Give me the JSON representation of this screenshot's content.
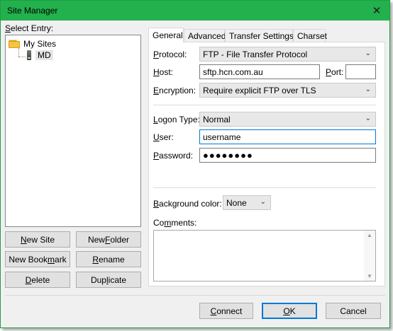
{
  "window": {
    "title": "Site Manager",
    "close_glyph": "✕"
  },
  "left": {
    "select_entry_label": "Select Entry:",
    "tree": {
      "root": "My Sites",
      "child": "MD"
    },
    "buttons": {
      "new_site": "New Site",
      "new_folder": "New Folder",
      "new_bookmark": "New Bookmark",
      "rename": "Rename",
      "delete": "Delete",
      "duplicate": "Duplicate"
    }
  },
  "tabs": [
    {
      "label": "General",
      "active": true
    },
    {
      "label": "Advanced",
      "active": false
    },
    {
      "label": "Transfer Settings",
      "active": false
    },
    {
      "label": "Charset",
      "active": false
    }
  ],
  "general": {
    "protocol_label": "Protocol:",
    "protocol_value": "FTP - File Transfer Protocol",
    "host_label": "Host:",
    "host_value": "sftp.hcn.com.au",
    "port_label": "Port:",
    "port_value": "",
    "encryption_label": "Encryption:",
    "encryption_value": "Require explicit FTP over TLS",
    "logon_type_label": "Logon Type:",
    "logon_type_value": "Normal",
    "user_label": "User:",
    "user_value": "username",
    "password_label": "Password:",
    "password_masked": "●●●●●●●●",
    "background_color_label": "Background color:",
    "background_color_value": "None",
    "comments_label": "Comments:",
    "comments_value": ""
  },
  "footer": {
    "connect": "Connect",
    "ok": "OK",
    "cancel": "Cancel"
  },
  "icons": {
    "folder": "folder-icon",
    "server": "server-icon",
    "dropdown": "chevron-down-icon",
    "close": "close-icon"
  },
  "colors": {
    "titlebar": "#22b14c",
    "focus_border": "#0078d7"
  }
}
